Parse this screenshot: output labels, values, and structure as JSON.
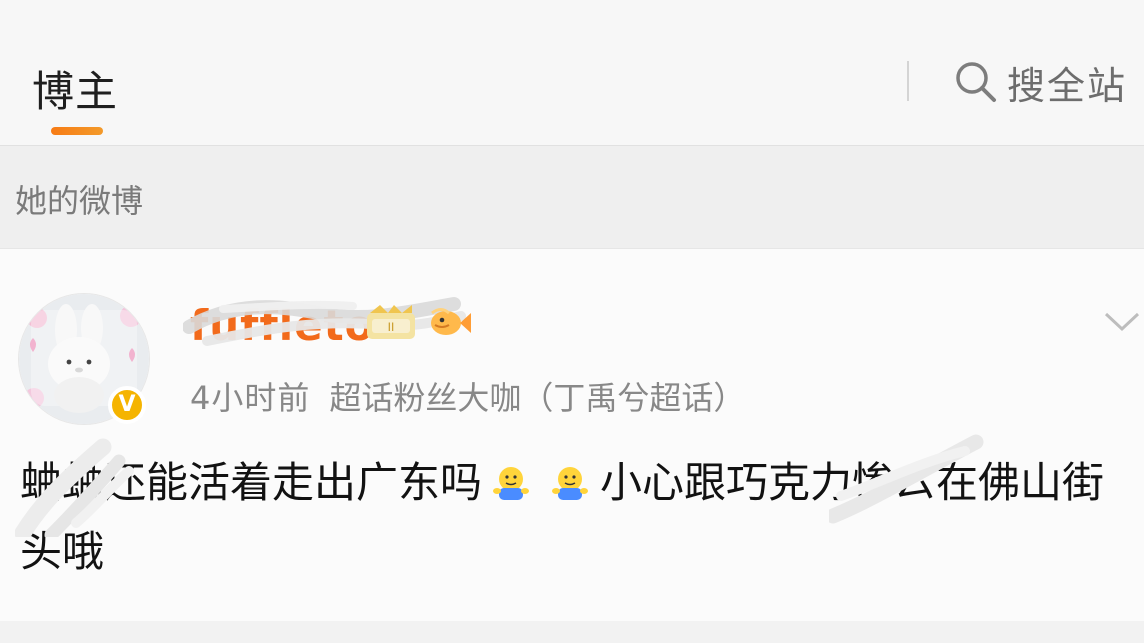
{
  "tabs": {
    "active_label": "博主"
  },
  "search": {
    "label": "搜全站"
  },
  "section": {
    "title": "她的微博"
  },
  "post": {
    "username": "fuffleto",
    "time": "4小时前",
    "fan_title": "超话粉丝大咖（丁禹兮超话）",
    "text_part1": "蛐蛐还能活着走出广东吗",
    "text_part2": "小心跟巧克力惨ㄙ在佛山街头哦",
    "verified_icon": "verified-v-icon",
    "emoji_icon": "shrug-emoji-icon"
  },
  "colors": {
    "accent_orange": "#f77b15",
    "verified_yellow": "#f5b400",
    "username_orange": "#f26a1b"
  }
}
